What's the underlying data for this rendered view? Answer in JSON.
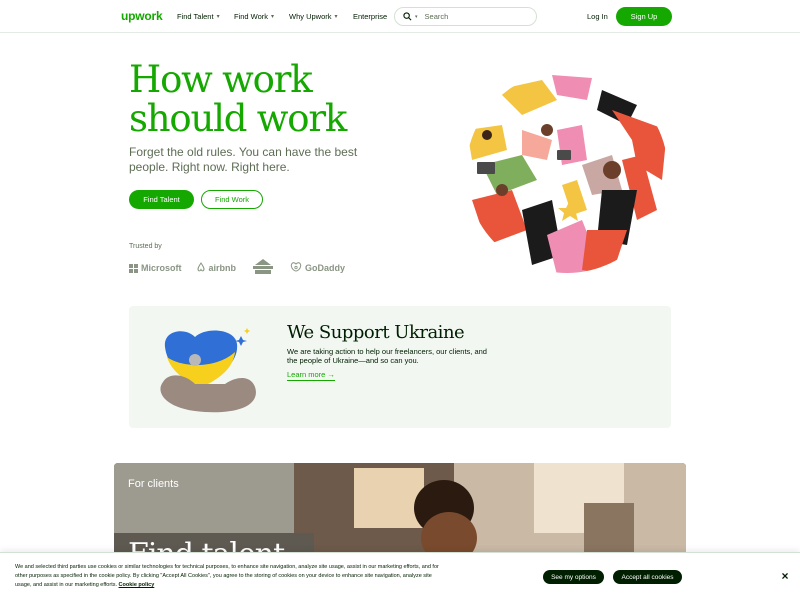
{
  "nav": {
    "logo": "upwork",
    "items": [
      {
        "label": "Find Talent",
        "caret": "⌄"
      },
      {
        "label": "Find Work",
        "caret": "⌄"
      },
      {
        "label": "Why Upwork",
        "caret": "⌄"
      },
      {
        "label": "Enterprise"
      }
    ],
    "search_placeholder": "Search",
    "login": "Log In",
    "signup": "Sign Up"
  },
  "hero": {
    "title": "How work should work",
    "subtitle": "Forget the old rules. You can have the best people. Right now. Right here.",
    "primary_button": "Find Talent",
    "secondary_button": "Find Work",
    "trusted_label": "Trusted by",
    "brands": [
      "Microsoft",
      "airbnb",
      "GoDaddy"
    ]
  },
  "ukraine": {
    "title": "We Support Ukraine",
    "text": "We are taking action to help our freelancers, our clients, and the people of Ukraine—and so can you.",
    "link": "Learn more →"
  },
  "clients": {
    "label": "For clients",
    "headline": "Find talent"
  },
  "cookie": {
    "text": "We and selected third parties use cookies or similar technologies for technical purposes, to enhance site navigation, analyze site usage, assist in our marketing efforts, and for other purposes as specified in the cookie policy. By clicking \"Accept All Cookies\", you agree to the storing of cookies on your device to enhance site navigation, analyze site usage, and assist in our marketing efforts.",
    "link": "Cookie policy",
    "options_button": "See my options",
    "accept_button": "Accept all cookies",
    "close": "×"
  },
  "colors": {
    "brand_green": "#14a800",
    "dark": "#001e00",
    "muted": "#5e6d55",
    "card_bg": "#f2f7f2"
  },
  "icons": [
    "search-icon",
    "microsoft-logo-icon",
    "airbnb-logo-icon",
    "godaddy-logo-icon",
    "close-icon"
  ]
}
